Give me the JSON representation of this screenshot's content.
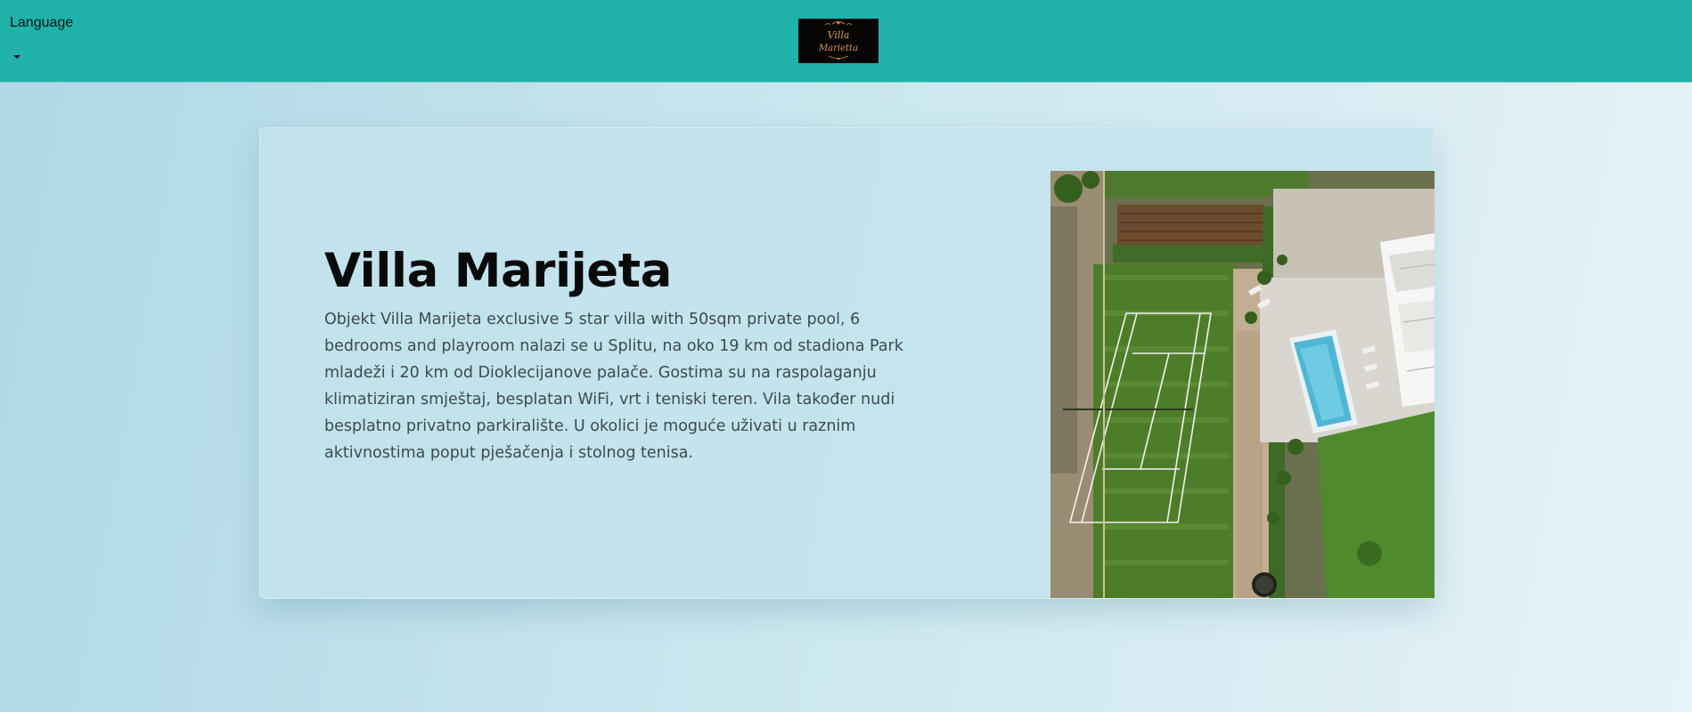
{
  "navbar": {
    "language_label": "Language",
    "logo_text_line1": "Villa",
    "logo_text_line2": "Marietta"
  },
  "hero": {
    "title": "Villa Marijeta",
    "description": "Objekt Villa Marijeta exclusive 5 star villa with 50sqm private pool, 6 bedrooms and playroom nalazi se u Splitu, na oko 19 km od stadiona Park mladeži i 20 km od Dioklecijanove palače. Gostima su na raspolaganju klimatiziran smještaj, besplatan WiFi, vrt i teniski teren. Vila također nudi besplatno privatno parkiralište. U okolici je moguće uživati u raznim aktivnostima poput pješačenja i stolnog tenisa."
  },
  "colors": {
    "navbar": "#20b2aa",
    "title": "#0a0a0a",
    "text": "#3e4a50"
  },
  "icons": {
    "language_dropdown": "caret-down-icon"
  }
}
